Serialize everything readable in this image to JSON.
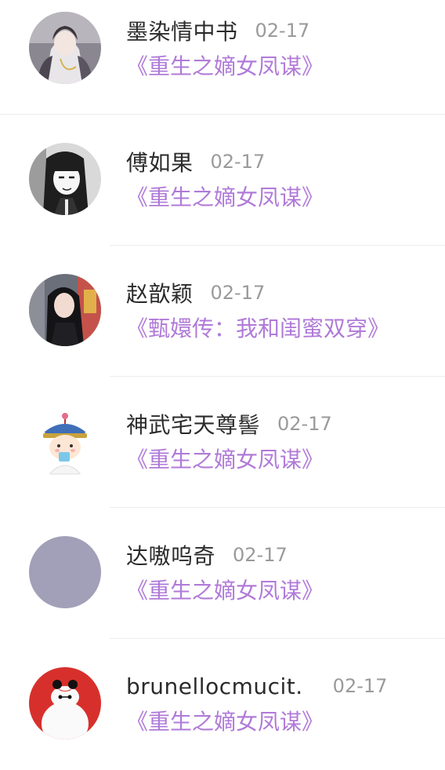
{
  "colors": {
    "username": "#2b2b2b",
    "date": "#9a9a9a",
    "book_title": "#b07ad8",
    "divider": "#ececec",
    "placeholder_avatar": "#a29fb8"
  },
  "feed": {
    "items": [
      {
        "username": "墨染情中书",
        "date": "02-17",
        "book": "《重生之嫡女凤谋》",
        "avatar": "anime-girl-avatar"
      },
      {
        "username": "傅如果",
        "date": "02-17",
        "book": "《重生之嫡女凤谋》",
        "avatar": "manga-girl-avatar"
      },
      {
        "username": "赵歆颖",
        "date": "02-17",
        "book": "《甄嬛传：我和闺蜜双穿》",
        "avatar": "photo-girl-avatar"
      },
      {
        "username": "神武宅天尊髻",
        "date": "02-17",
        "book": "《重生之嫡女凤谋》",
        "avatar": "cartoon-qing-official-avatar"
      },
      {
        "username": "达嗷呜奇",
        "date": "02-17",
        "book": "《重生之嫡女凤谋》",
        "avatar": "default-avatar"
      },
      {
        "username": "brunellocmucit.",
        "date": "02-17",
        "book": "《重生之嫡女凤谋》",
        "avatar": "baymax-avatar"
      }
    ]
  }
}
